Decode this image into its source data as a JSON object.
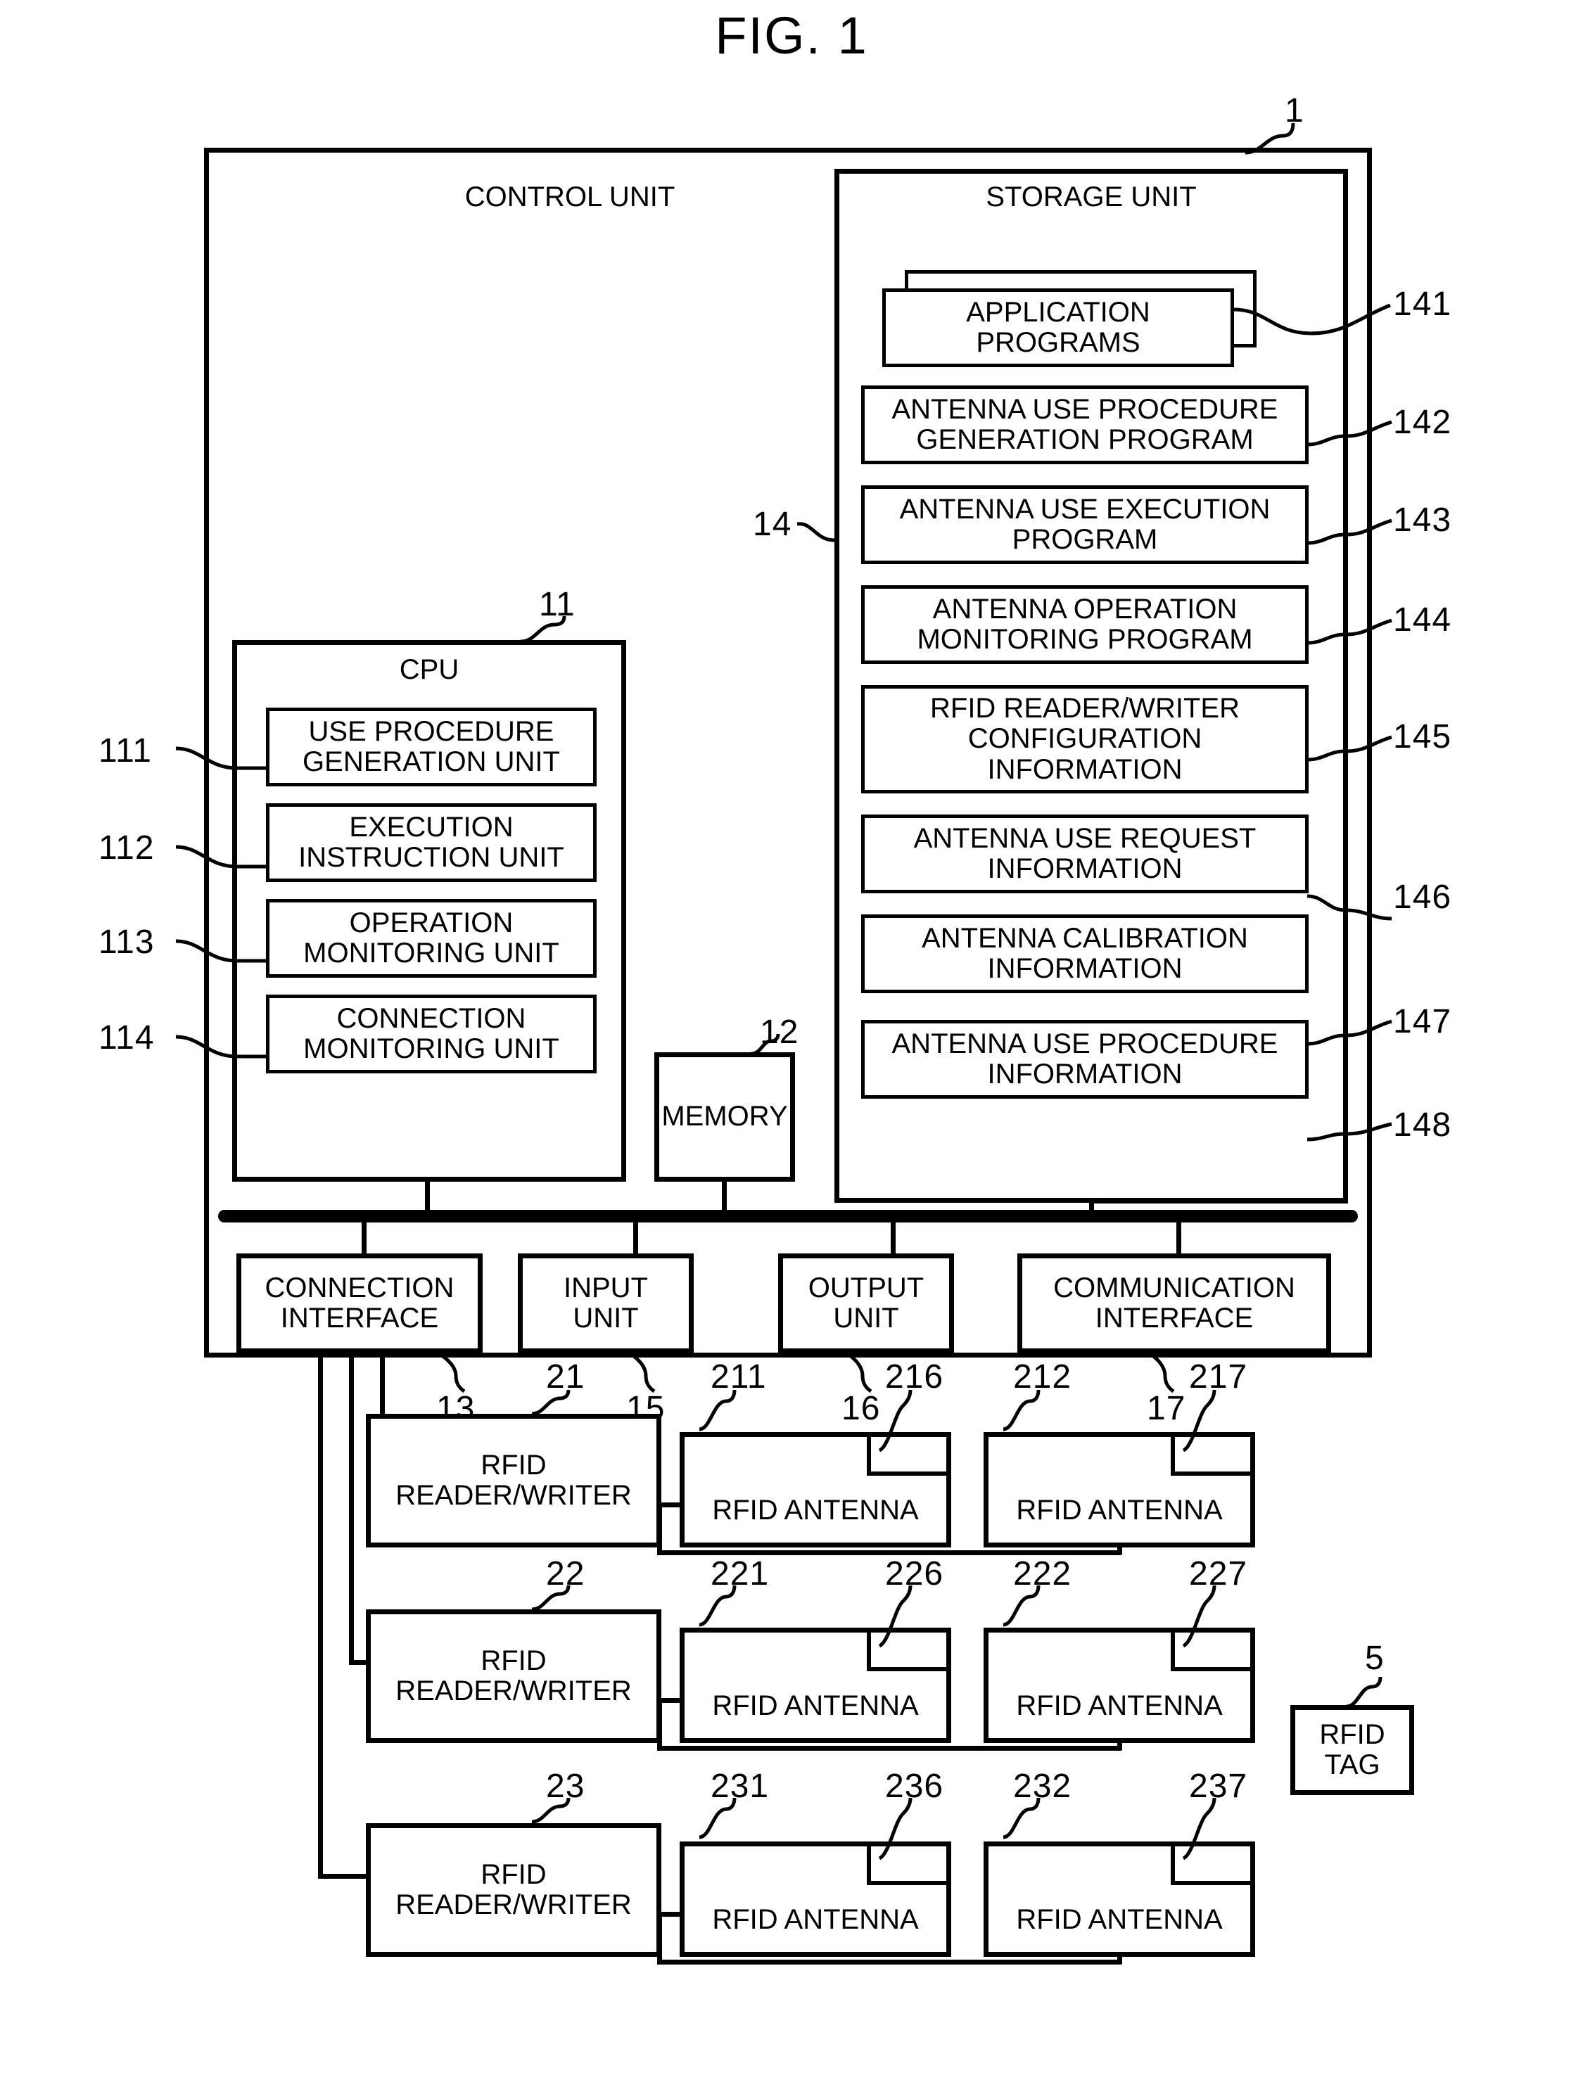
{
  "figure": {
    "title": "FIG. 1",
    "system_ref": "1"
  },
  "control_unit": {
    "title": "CONTROL UNIT"
  },
  "storage_unit": {
    "title": "STORAGE UNIT",
    "ref": "14",
    "items": [
      {
        "label": "APPLICATION\nPROGRAMS",
        "ref": "141"
      },
      {
        "label": "ANTENNA USE PROCEDURE\nGENERATION PROGRAM",
        "ref": "142"
      },
      {
        "label": "ANTENNA USE EXECUTION\nPROGRAM",
        "ref": "143"
      },
      {
        "label": "ANTENNA OPERATION\nMONITORING PROGRAM",
        "ref": "144"
      },
      {
        "label": "RFID READER/WRITER\nCONFIGURATION\nINFORMATION",
        "ref": "145"
      },
      {
        "label": "ANTENNA USE REQUEST\nINFORMATION",
        "ref": "146"
      },
      {
        "label": "ANTENNA CALIBRATION\nINFORMATION",
        "ref": "147"
      },
      {
        "label": "ANTENNA USE PROCEDURE\nINFORMATION",
        "ref": "148"
      }
    ]
  },
  "cpu": {
    "title": "CPU",
    "ref": "11",
    "units": [
      {
        "label": "USE PROCEDURE\nGENERATION UNIT",
        "ref": "111"
      },
      {
        "label": "EXECUTION\nINSTRUCTION UNIT",
        "ref": "112"
      },
      {
        "label": "OPERATION\nMONITORING UNIT",
        "ref": "113"
      },
      {
        "label": "CONNECTION\nMONITORING UNIT",
        "ref": "114"
      }
    ]
  },
  "memory": {
    "label": "MEMORY",
    "ref": "12"
  },
  "interfaces": [
    {
      "label": "CONNECTION\nINTERFACE",
      "ref": "13"
    },
    {
      "label": "INPUT\nUNIT",
      "ref": "15"
    },
    {
      "label": "OUTPUT\nUNIT",
      "ref": "16"
    },
    {
      "label": "COMMUNICATION\nINTERFACE",
      "ref": "17"
    }
  ],
  "rfid_rows": [
    {
      "reader": {
        "label": "RFID\nREADER/WRITER",
        "ref": "21"
      },
      "antennas": [
        {
          "label": "RFID ANTENNA",
          "ref": "211",
          "sub_ref": "216"
        },
        {
          "label": "RFID ANTENNA",
          "ref": "212",
          "sub_ref": "217"
        }
      ]
    },
    {
      "reader": {
        "label": "RFID\nREADER/WRITER",
        "ref": "22"
      },
      "antennas": [
        {
          "label": "RFID ANTENNA",
          "ref": "221",
          "sub_ref": "226"
        },
        {
          "label": "RFID ANTENNA",
          "ref": "222",
          "sub_ref": "227"
        }
      ]
    },
    {
      "reader": {
        "label": "RFID\nREADER/WRITER",
        "ref": "23"
      },
      "antennas": [
        {
          "label": "RFID ANTENNA",
          "ref": "231",
          "sub_ref": "236"
        },
        {
          "label": "RFID ANTENNA",
          "ref": "232",
          "sub_ref": "237"
        }
      ]
    }
  ],
  "rfid_tag": {
    "label": "RFID\nTAG",
    "ref": "5"
  },
  "colors": {
    "ink": "#000000",
    "paper": "#ffffff"
  }
}
